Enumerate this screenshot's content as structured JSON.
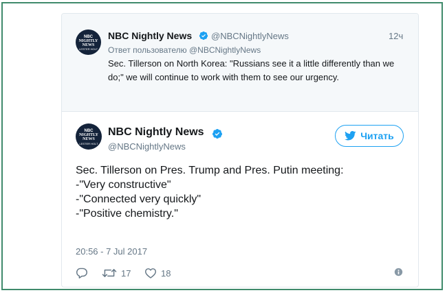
{
  "brand": {
    "avatar_top": "NBC",
    "avatar_main_1": "NIGHTLY",
    "avatar_main_2": "NEWS",
    "avatar_sub": "LESTER HOLT",
    "verified_color": "#1da1f2",
    "link_blue": "#1da1f2",
    "frame_color": "#3f8a6b"
  },
  "parent_tweet": {
    "name": "NBC Nightly News",
    "handle": "@NBCNightlyNews",
    "time": "12ч",
    "reply_to": "Ответ пользователю @NBCNightlyNews",
    "text": "Sec. Tillerson on North Korea: \"Russians see it a little differently than we do;\" we will continue to work with them to see our urgency."
  },
  "tweet": {
    "name": "NBC Nightly News",
    "handle": "@NBCNightlyNews",
    "follow_label": "Читать",
    "body_lines": [
      "Sec. Tillerson on Pres. Trump and Pres. Putin meeting:",
      "",
      "-\"Very constructive\"",
      "-\"Connected very quickly\"",
      "-\"Positive chemistry.\""
    ],
    "date": "20:56 - 7 Jul 2017",
    "actions": {
      "retweets": "17",
      "likes": "18"
    }
  }
}
